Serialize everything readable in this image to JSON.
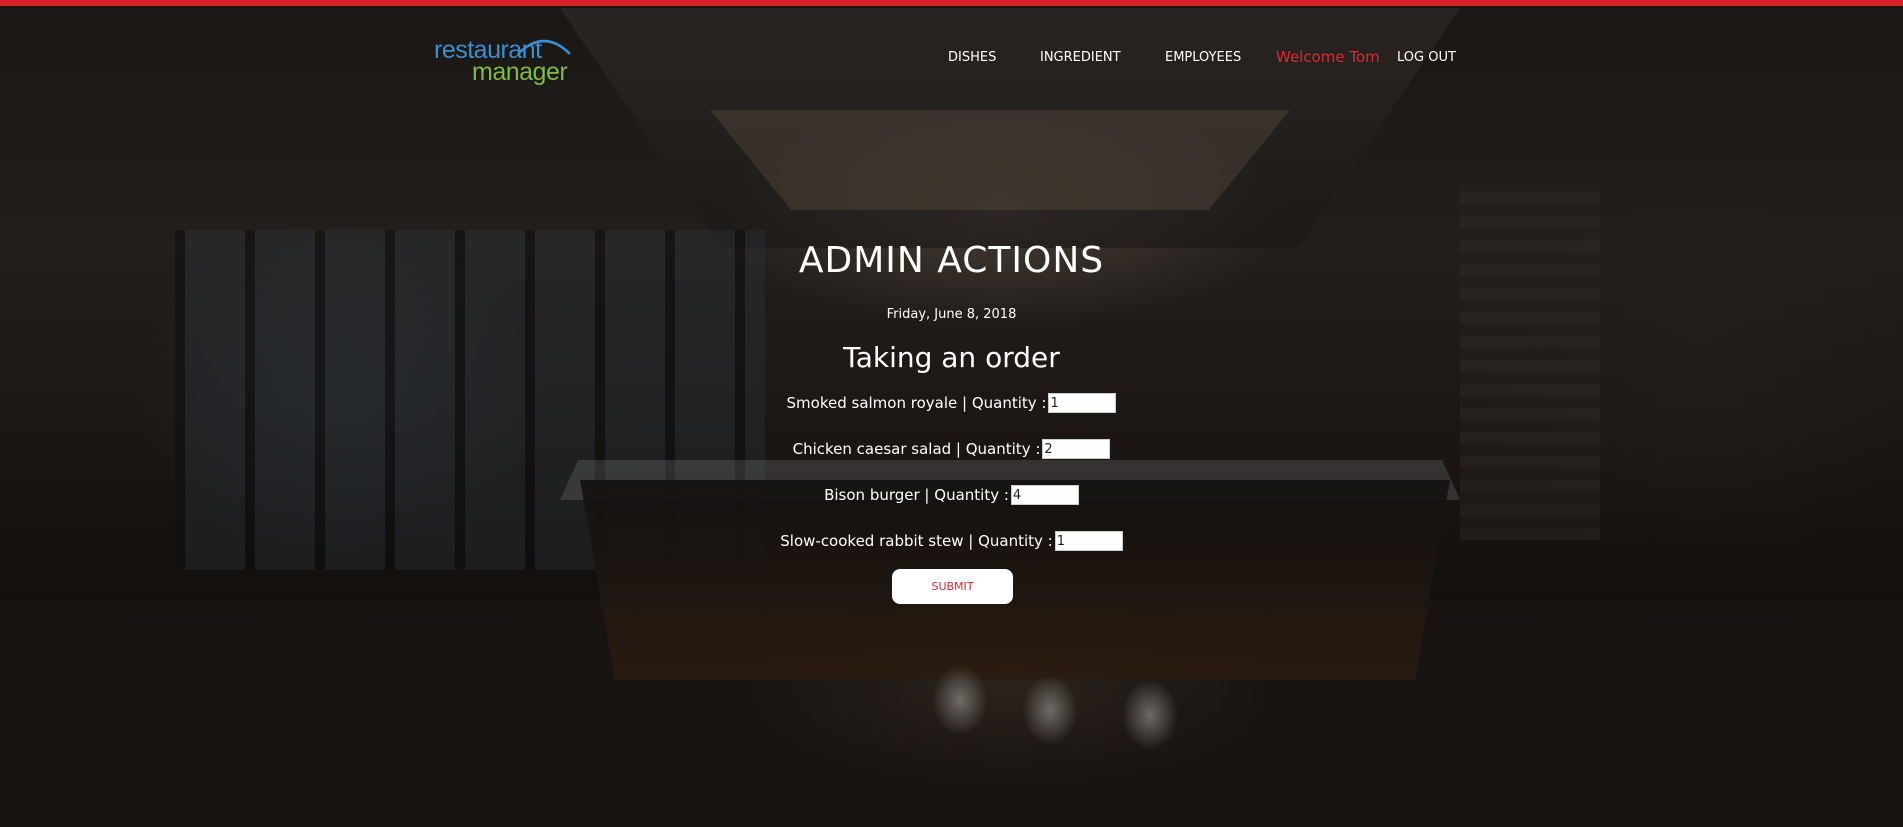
{
  "logo": {
    "line1": "restaurant",
    "line2": "manager"
  },
  "nav": {
    "dishes": "DISHES",
    "ingredient": "INGREDIENT",
    "employees": "EMPLOYEES",
    "welcome": "Welcome Tom",
    "logout": "LOG OUT"
  },
  "main": {
    "title": "ADMIN ACTIONS",
    "date": "Friday, June 8, 2018",
    "section_title": "Taking an order",
    "orders": [
      {
        "label": "Smoked salmon royale | Quantity :",
        "quantity": "1"
      },
      {
        "label": "Chicken caesar salad | Quantity :",
        "quantity": "2"
      },
      {
        "label": "Bison burger | Quantity :",
        "quantity": "4"
      },
      {
        "label": "Slow-cooked rabbit stew | Quantity :",
        "quantity": "1"
      }
    ],
    "submit_label": "SUBMIT"
  },
  "colors": {
    "accent_red": "#e0282f",
    "top_bar": "#d8232a",
    "logo_blue": "#3a8fd0",
    "logo_green": "#7dbb43"
  },
  "icons": {
    "logo_arc": "logo-arc-icon"
  }
}
